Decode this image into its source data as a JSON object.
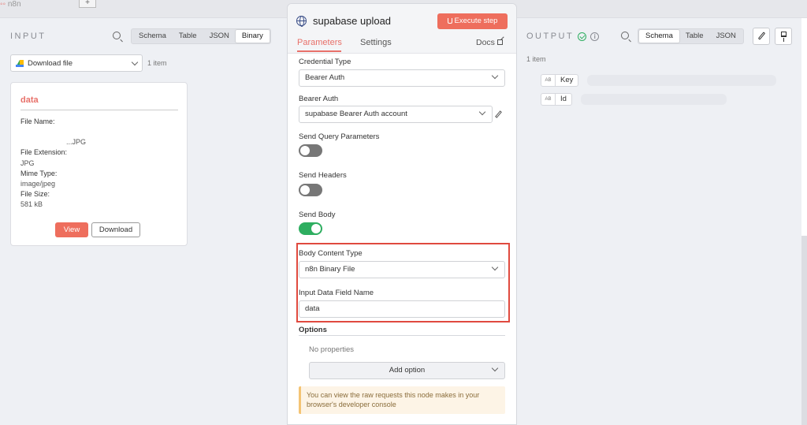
{
  "topbar": {
    "logo": "n8n",
    "plus": "+"
  },
  "input_panel": {
    "title": "INPUT",
    "view_tabs": [
      "Schema",
      "Table",
      "JSON",
      "Binary"
    ],
    "active_tab": "Binary",
    "node_select": "Download file",
    "item_count": "1 item",
    "card": {
      "title": "data",
      "file_name_label": "File Name:",
      "file_name_value": "...JPG",
      "file_extension_label": "File Extension:",
      "file_extension_value": "JPG",
      "mime_type_label": "Mime Type:",
      "mime_type_value": "image/jpeg",
      "file_size_label": "File Size:",
      "file_size_value": "581 kB",
      "view_label": "View",
      "download_label": "Download"
    }
  },
  "dialog": {
    "title": "supabase upload",
    "execute_label": "Execute step",
    "tabs": {
      "parameters": "Parameters",
      "settings": "Settings",
      "docs": "Docs"
    },
    "credential_type_label": "Credential Type",
    "credential_type_value": "Bearer Auth",
    "bearer_auth_label": "Bearer Auth",
    "bearer_auth_value": "supabase Bearer Auth account",
    "send_query_label": "Send Query Parameters",
    "send_query_on": false,
    "send_headers_label": "Send Headers",
    "send_headers_on": false,
    "send_body_label": "Send Body",
    "send_body_on": true,
    "body_content_type_label": "Body Content Type",
    "body_content_type_value": "n8n Binary File",
    "input_field_label": "Input Data Field Name",
    "input_field_value": "data",
    "options_label": "Options",
    "no_properties": "No properties",
    "add_option": "Add option",
    "notice": "You can view the raw requests this node makes in your browser's developer console"
  },
  "output_panel": {
    "title": "OUTPUT",
    "view_tabs": [
      "Schema",
      "Table",
      "JSON"
    ],
    "active_tab": "Schema",
    "item_count": "1 item",
    "fields": [
      {
        "type": "AB",
        "name": "Key"
      },
      {
        "type": "AB",
        "name": "Id"
      }
    ]
  },
  "colors": {
    "accent": "#ee6e5d",
    "success": "#2eae60",
    "highlight": "#e04a3f"
  }
}
